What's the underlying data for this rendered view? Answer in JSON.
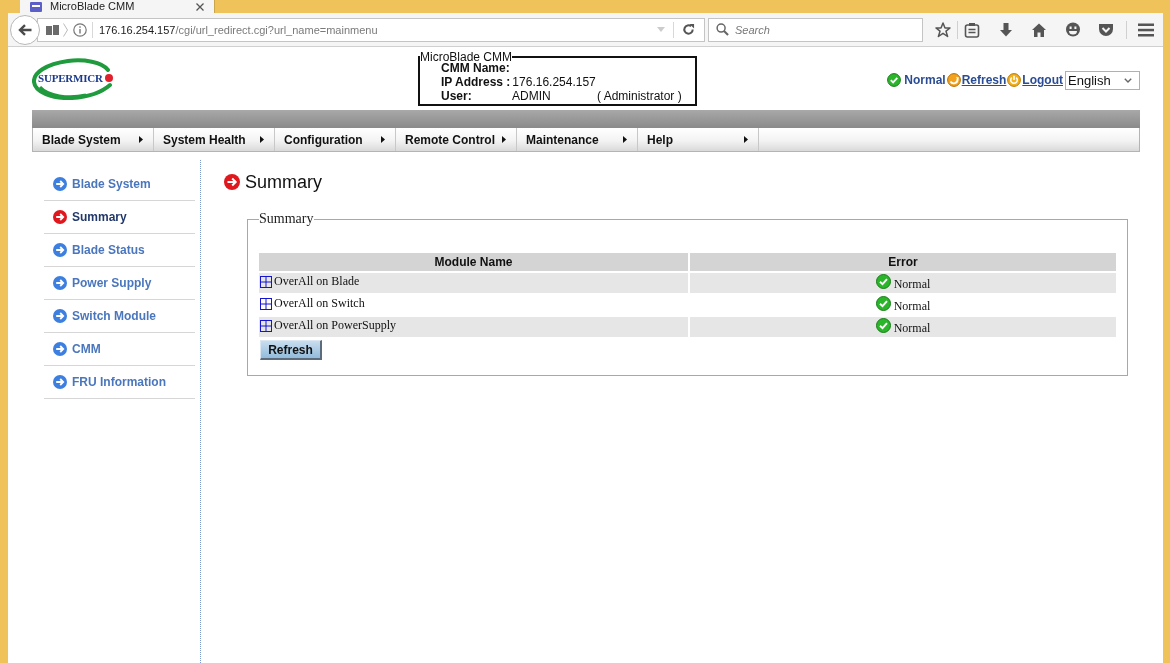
{
  "browser": {
    "tab_title": "MicroBlade CMM",
    "address": {
      "host": "176.16.254.157",
      "path": "/cgi/url_redirect.cgi?url_name=mainmenu"
    },
    "search": {
      "placeholder": "Search"
    }
  },
  "header": {
    "logo_text": "SUPERMICR",
    "info": {
      "legend": "MicroBlade CMM",
      "rows": [
        {
          "label": "CMM Name:"
        },
        {
          "label": "IP Address :",
          "value": "176.16.254.157"
        },
        {
          "label": "User:",
          "value": "ADMIN",
          "note": "( Administrator )"
        }
      ]
    },
    "status": {
      "text": "Normal",
      "links": [
        {
          "label": "Refresh",
          "kind": "refresh"
        },
        {
          "label": "Logout",
          "kind": "logout"
        }
      ],
      "language": "English"
    }
  },
  "menu": [
    "Blade System",
    "System Health",
    "Configuration",
    "Remote Control",
    "Maintenance",
    "Help"
  ],
  "sidebar": {
    "items": [
      {
        "label": "Blade System",
        "selected": false
      },
      {
        "label": "Summary",
        "selected": true
      },
      {
        "label": "Blade Status",
        "selected": false
      },
      {
        "label": "Power Supply",
        "selected": false
      },
      {
        "label": "Switch Module",
        "selected": false
      },
      {
        "label": "CMM",
        "selected": false
      },
      {
        "label": "FRU Information",
        "selected": false
      }
    ]
  },
  "content": {
    "title": "Summary",
    "panel": {
      "legend": "Summary",
      "table": {
        "columns": [
          "Module Name",
          "Error"
        ],
        "rows": [
          {
            "module": "OverAll on Blade",
            "error": "Normal"
          },
          {
            "module": "OverAll on Switch",
            "error": "Normal"
          },
          {
            "module": "OverAll on PowerSupply",
            "error": "Normal"
          }
        ]
      },
      "button": "Refresh"
    }
  }
}
